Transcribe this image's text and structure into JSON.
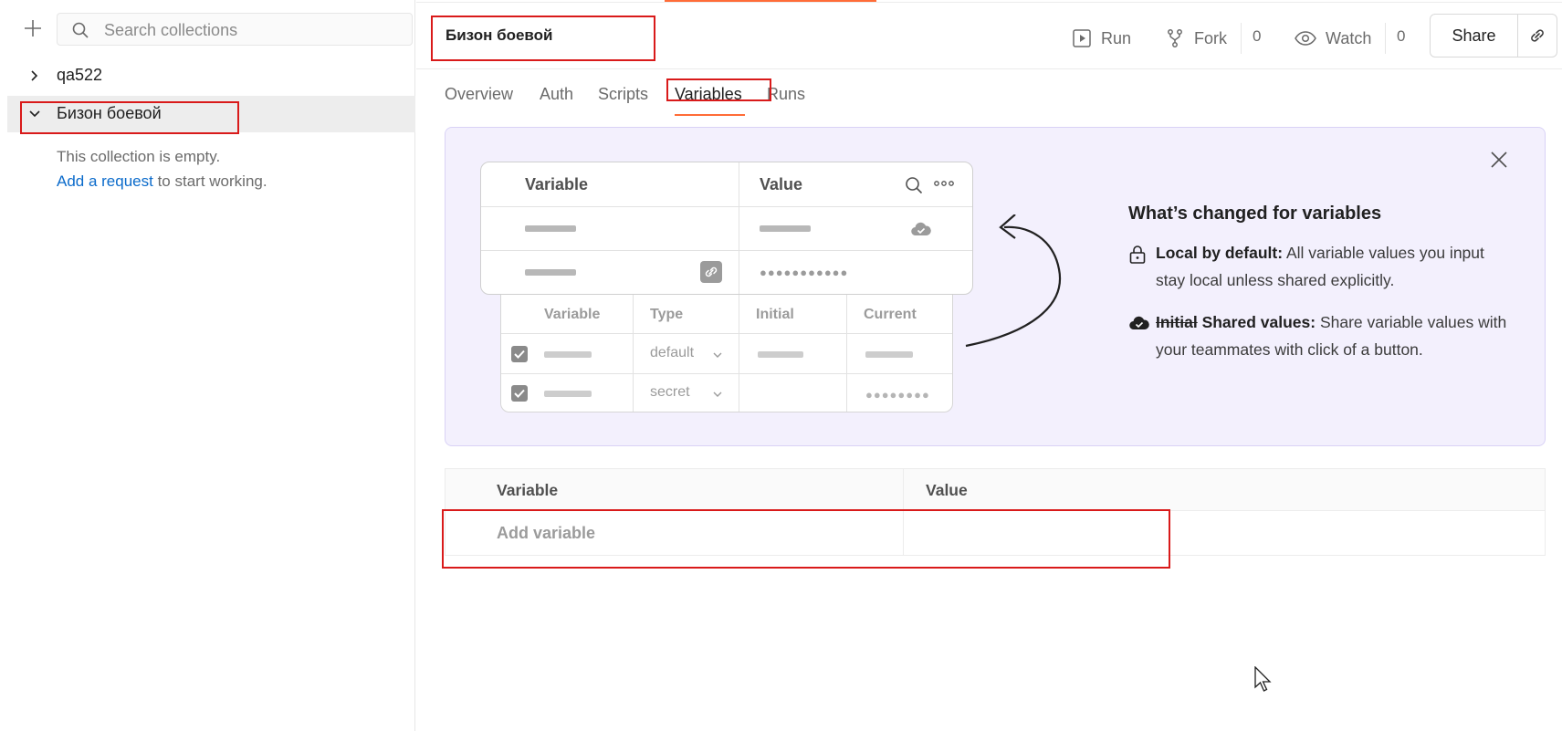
{
  "sidebar": {
    "new_icon": "plus-icon",
    "search": {
      "placeholder": "Search collections",
      "icon": "search-icon"
    },
    "collections": [
      {
        "name": "qa522",
        "expanded": false
      },
      {
        "name": "Бизон боевой",
        "expanded": true
      }
    ],
    "empty": {
      "text": "This collection is empty.",
      "link": "Add a request",
      "suffix": " to start working."
    }
  },
  "header": {
    "title": "Бизон боевой",
    "run_label": "Run",
    "fork_label": "Fork",
    "fork_count": "0",
    "watch_label": "Watch",
    "watch_count": "0",
    "share_label": "Share",
    "accent_color": "#ff6c37"
  },
  "tabs": [
    {
      "label": "Overview",
      "active": false
    },
    {
      "label": "Auth",
      "active": false
    },
    {
      "label": "Scripts",
      "active": false
    },
    {
      "label": "Variables",
      "active": true
    },
    {
      "label": "Runs",
      "active": false
    }
  ],
  "banner": {
    "background": "#f3f0fd",
    "title": "What’s changed for variables",
    "items": [
      {
        "icon": "lock-icon",
        "bold": "Local by default:",
        "text": " All variable values you input stay local unless shared explicitly."
      },
      {
        "icon": "cloud-check-icon",
        "strike": "Initial",
        "bold": " Shared values:",
        "text": " Share variable values with your teammates with click of a button."
      }
    ],
    "illustration": {
      "new_table": {
        "col_variable": "Variable",
        "col_value": "Value"
      },
      "old_table": {
        "col_variable": "Variable",
        "col_type": "Type",
        "col_initial": "Initial",
        "col_current": "Current",
        "row1_type": "default",
        "row2_type": "secret"
      },
      "masked_long": "●●●●●●●●●●●",
      "masked_short": "●●●●●●●●"
    }
  },
  "variables_table": {
    "col_variable": "Variable",
    "col_value": "Value",
    "add_placeholder": "Add variable"
  }
}
